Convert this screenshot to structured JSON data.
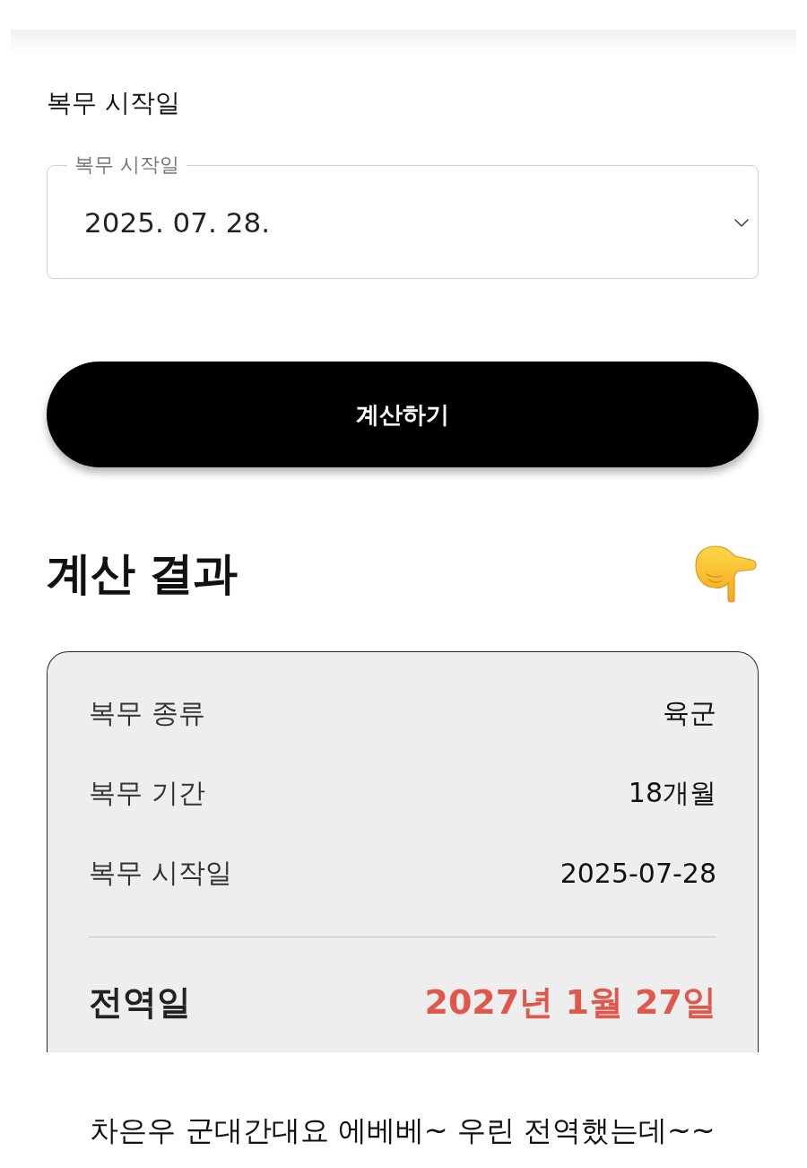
{
  "start_date": {
    "heading": "복무 시작일",
    "date_field": {
      "label": "복무 시작일",
      "value": "2025. 07. 28."
    }
  },
  "calculate_button": "계산하기",
  "result": {
    "title": "계산 결과",
    "rows": [
      {
        "label": "복무 종류",
        "value": "육군"
      },
      {
        "label": "복무 기간",
        "value": "18개월"
      },
      {
        "label": "복무 시작일",
        "value": "2025-07-28"
      }
    ],
    "discharge": {
      "label": "전역일",
      "value": "2027년 1월 27일"
    }
  },
  "caption": "차은우 군대간대요 에베베~ 우린 전역했는데~~"
}
